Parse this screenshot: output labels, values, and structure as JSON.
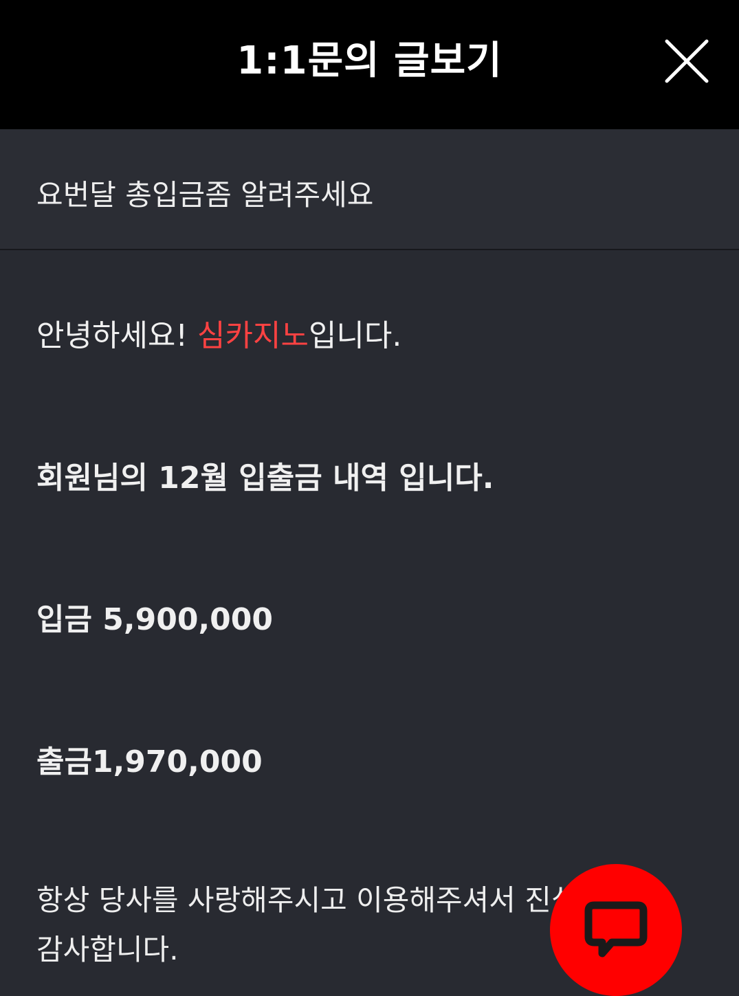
{
  "header": {
    "title": "1:1문의 글보기",
    "close_icon": "close-icon"
  },
  "inquiry": {
    "subject": "요번달 총입금좀 알려주세요"
  },
  "answer": {
    "greeting_prefix": "안녕하세요! ",
    "brand_name": "심카지노",
    "greeting_suffix": "입니다.",
    "history_title": "회원님의 12월 입출금 내역 입니다.",
    "deposit_label": "입금 ",
    "deposit_amount": "5,900,000",
    "withdraw_label": "출금",
    "withdraw_amount": "1,970,000",
    "closing": "항상 당사를 사랑해주시고 이용해주셔서 진심으로 감사합니다."
  },
  "chat": {
    "icon": "chat-bubble-icon"
  },
  "colors": {
    "header_bg": "#000000",
    "page_bg": "#282a31",
    "brand": "#ff4242",
    "chat_button": "#ff0000"
  }
}
